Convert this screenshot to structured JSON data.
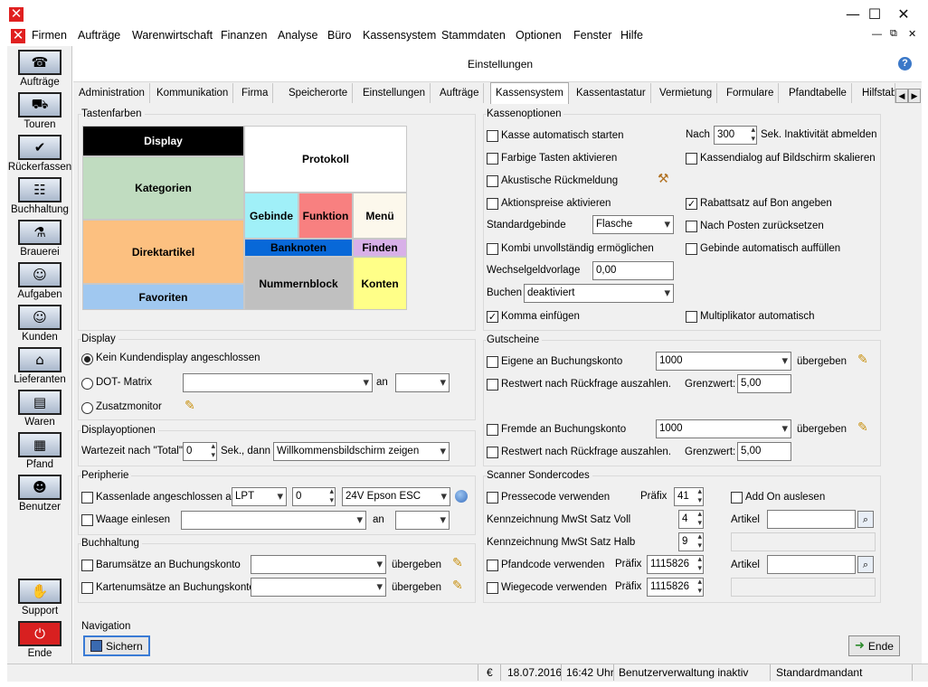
{
  "menu": [
    "Firmen",
    "Aufträge",
    "Warenwirtschaft",
    "Finanzen",
    "Analyse",
    "Büro",
    "Kassensystem",
    "Stammdaten",
    "Optionen",
    "Fenster",
    "Hilfe"
  ],
  "window": {
    "title": "Einstellungen",
    "help_icon": "?"
  },
  "sidebar": [
    "Aufträge",
    "Touren",
    "Rückerfassen",
    "Buchhaltung",
    "Brauerei",
    "Aufgaben",
    "Kunden",
    "Lieferanten",
    "Waren",
    "Pfand",
    "Benutzer",
    "Support",
    "Ende"
  ],
  "tabs": [
    "Administration",
    "Kommunikation",
    "Firma",
    "Speicherorte",
    "Einstellungen",
    "Aufträge",
    "Kassensystem",
    "Kassentastatur",
    "Vermietung",
    "Formulare",
    "Pfandtabelle",
    "Hilfstab"
  ],
  "colors": {
    "display": "#000000",
    "kategorien": "#c0dcc0",
    "direktartikel": "#fcc080",
    "favoriten": "#a0c8f0",
    "protokoll": "#ffffff",
    "gebinde": "#a0f0f8",
    "funktion": "#f88080",
    "menu": "#fcf8ec",
    "banknoten": "#0868d8",
    "finden": "#d8b0e8",
    "nummernblock": "#c0c0c0",
    "konten": "#ffff88"
  },
  "tastenfarben": {
    "title": "Tastenfarben",
    "display": "Display",
    "kategorien": "Kategorien",
    "direktartikel": "Direktartikel",
    "favoriten": "Favoriten",
    "protokoll": "Protokoll",
    "gebinde": "Gebinde",
    "funktion": "Funktion",
    "menu": "Menü",
    "banknoten": "Banknoten",
    "finden": "Finden",
    "nummernblock": "Nummernblock",
    "konten": "Konten"
  },
  "display": {
    "title": "Display",
    "kein": "Kein Kundendisplay angeschlossen",
    "dot": "DOT- Matrix",
    "an": "an",
    "zusatz": "Zusatzmonitor"
  },
  "displayoptionen": {
    "title": "Displayoptionen",
    "wartezeit": "Wartezeit nach \"Total\"",
    "wartezeit_val": "0",
    "sek": "Sek., dann",
    "dann_val": "Willkommensbildschirm zeigen"
  },
  "peripherie": {
    "title": "Peripherie",
    "kassenlade": "Kassenlade angeschlossen an",
    "port": "LPT",
    "port_num": "0",
    "device": "24V Epson ESC",
    "waage": "Waage einlesen",
    "an": "an"
  },
  "buchhaltung": {
    "title": "Buchhaltung",
    "bar": "Barumsätze an Buchungskonto",
    "karte": "Kartenumsätze an Buchungskonto",
    "uebergeben": "übergeben"
  },
  "kassenoptionen": {
    "title": "Kassenoptionen",
    "auto_start": "Kasse automatisch starten",
    "nach": "Nach",
    "nach_val": "300",
    "inakt": "Sek. Inaktivität abmelden",
    "farbige": "Farbige Tasten aktivieren",
    "skalieren": "Kassendialog auf Bildschirm skalieren",
    "akustisch": "Akustische Rückmeldung",
    "aktionspreise": "Aktionspreise aktivieren",
    "rabatt": "Rabattsatz auf Bon angeben",
    "std_gebinde": "Standardgebinde",
    "std_gebinde_val": "Flasche",
    "nach_posten": "Nach Posten zurücksetzen",
    "kombi": "Kombi unvollständig ermöglichen",
    "gebinde_auffuellen": "Gebinde automatisch auffüllen",
    "wechselgeld": "Wechselgeldvorlage",
    "wechselgeld_val": "0,00",
    "buchen": "Buchen",
    "buchen_val": "deaktiviert",
    "komma": "Komma einfügen",
    "multiplikator": "Multiplikator automatisch"
  },
  "gutscheine": {
    "title": "Gutscheine",
    "eigene": "Eigene an Buchungskonto",
    "eigene_val": "1000",
    "uebergeben": "übergeben",
    "restwert": "Restwert nach Rückfrage auszahlen.",
    "grenzwert": "Grenzwert:",
    "grenzwert_val": "5,00",
    "fremde": "Fremde an Buchungskonto",
    "fremde_val": "1000"
  },
  "scanner": {
    "title": "Scanner Sondercodes",
    "presse": "Pressecode verwenden",
    "praefix": "Präfix",
    "presse_val": "41",
    "addon": "Add On auslesen",
    "voll": "Kennzeichnung MwSt Satz Voll",
    "voll_val": "4",
    "artikel": "Artikel",
    "halb": "Kennzeichnung MwSt Satz Halb",
    "halb_val": "9",
    "pfand": "Pfandcode verwenden",
    "pfand_val": "1115826",
    "wiege": "Wiegecode verwenden",
    "wiege_val": "1115826"
  },
  "navigation": {
    "title": "Navigation",
    "sichern": "Sichern",
    "ende": "Ende"
  },
  "status": {
    "currency": "€",
    "date": "18.07.2016",
    "time": "16:42 Uhr",
    "user": "Benutzerverwaltung inaktiv",
    "mandant": "Standardmandant"
  }
}
